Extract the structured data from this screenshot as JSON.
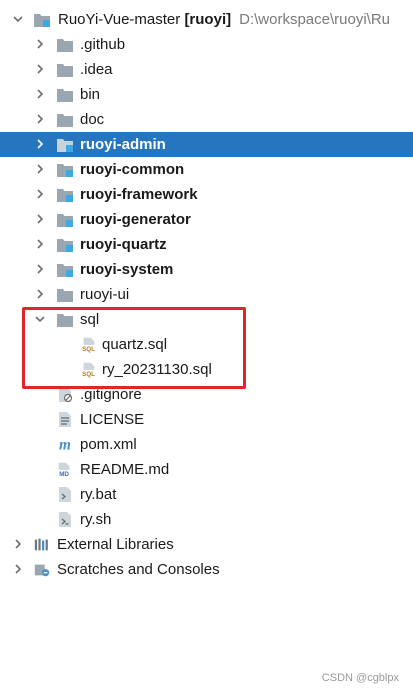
{
  "project": {
    "name": "RuoYi-Vue-master",
    "module": "[ruoyi]",
    "path": "D:\\workspace\\ruoyi\\Ru"
  },
  "tree": [
    {
      "label": ".github",
      "icon": "folder-icon",
      "bold": false
    },
    {
      "label": ".idea",
      "icon": "folder-icon",
      "bold": false
    },
    {
      "label": "bin",
      "icon": "folder-icon",
      "bold": false
    },
    {
      "label": "doc",
      "icon": "folder-icon",
      "bold": false
    },
    {
      "label": "ruoyi-admin",
      "icon": "module-folder-icon",
      "bold": true,
      "selected": true
    },
    {
      "label": "ruoyi-common",
      "icon": "module-folder-icon",
      "bold": true
    },
    {
      "label": "ruoyi-framework",
      "icon": "module-folder-icon",
      "bold": true
    },
    {
      "label": "ruoyi-generator",
      "icon": "module-folder-icon",
      "bold": true
    },
    {
      "label": "ruoyi-quartz",
      "icon": "module-folder-icon",
      "bold": true
    },
    {
      "label": "ruoyi-system",
      "icon": "module-folder-icon",
      "bold": true
    },
    {
      "label": "ruoyi-ui",
      "icon": "folder-icon",
      "bold": false
    },
    {
      "label": "sql",
      "icon": "folder-icon",
      "expanded": true
    },
    {
      "label": "quartz.sql",
      "icon": "sql-file-icon",
      "badge": "SQL"
    },
    {
      "label": "ry_20231130.sql",
      "icon": "sql-file-icon",
      "badge": "SQL"
    },
    {
      "label": ".gitignore",
      "icon": "gitignore-file-icon"
    },
    {
      "label": "LICENSE",
      "icon": "text-file-icon"
    },
    {
      "label": "pom.xml",
      "icon": "maven-icon",
      "glyph": "m"
    },
    {
      "label": "README.md",
      "icon": "markdown-file-icon",
      "badge": "MD"
    },
    {
      "label": "ry.bat",
      "icon": "batch-file-icon"
    },
    {
      "label": "ry.sh",
      "icon": "shell-file-icon"
    },
    {
      "label": "External Libraries",
      "icon": "libraries-icon"
    },
    {
      "label": "Scratches and Consoles",
      "icon": "scratches-icon"
    }
  ],
  "watermark": "CSDN @cgblpx",
  "colors": {
    "selection": "#2675bf",
    "folder": "#9aa7b0",
    "module_marker": "#40a8e0",
    "highlight": "#e0252b",
    "sql_badge": "#c17a16",
    "markdown_badge": "#3c6fb0",
    "maven": "#4a90c8"
  }
}
